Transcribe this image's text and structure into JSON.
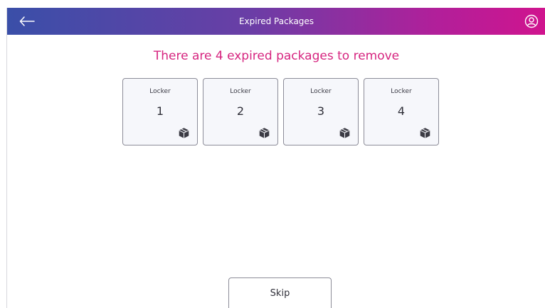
{
  "header": {
    "title": "Expired Packages",
    "back_icon": "arrow-left-icon",
    "profile_icon": "user-circle-icon",
    "gradient_start": "#3a4fa8",
    "gradient_end": "#d0148e"
  },
  "main": {
    "headline": "There are 4 expired packages to remove",
    "headline_color": "#d6247f",
    "lockers": [
      {
        "label": "Locker",
        "number": "1",
        "icon": "package-icon"
      },
      {
        "label": "Locker",
        "number": "2",
        "icon": "package-icon"
      },
      {
        "label": "Locker",
        "number": "3",
        "icon": "package-icon"
      },
      {
        "label": "Locker",
        "number": "4",
        "icon": "package-icon"
      }
    ]
  },
  "footer": {
    "skip_label": "Skip"
  }
}
